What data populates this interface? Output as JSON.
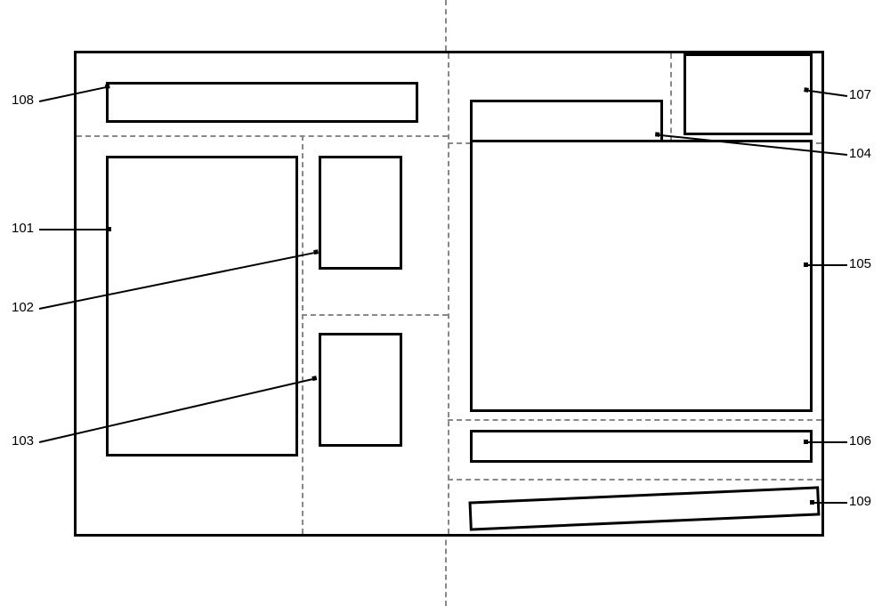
{
  "labels": {
    "l108": "108",
    "l101": "101",
    "l102": "102",
    "l103": "103",
    "l107": "107",
    "l104": "104",
    "l105": "105",
    "l106": "106",
    "l109": "109"
  }
}
